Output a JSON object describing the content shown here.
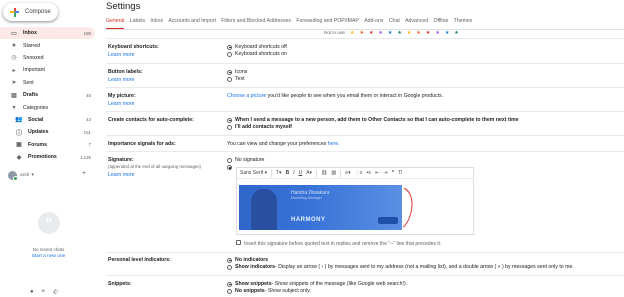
{
  "sidebar": {
    "compose_label": "Compose",
    "items": [
      {
        "label": "Inbox",
        "count": "189",
        "icon": "inbox-icon",
        "glyph": "▭",
        "active": true
      },
      {
        "label": "Starred",
        "count": "",
        "icon": "star-icon",
        "glyph": "★"
      },
      {
        "label": "Snoozed",
        "count": "",
        "icon": "clock-icon",
        "glyph": "◷"
      },
      {
        "label": "Important",
        "count": "",
        "icon": "important-icon",
        "glyph": "▸"
      },
      {
        "label": "Sent",
        "count": "",
        "icon": "send-icon",
        "glyph": "➤"
      },
      {
        "label": "Drafts",
        "count": "45",
        "icon": "draft-icon",
        "glyph": "▤",
        "bold": true
      },
      {
        "label": "Categories",
        "count": "",
        "icon": "label-icon",
        "glyph": "▾"
      },
      {
        "label": "Social",
        "count": "43",
        "icon": "people-icon",
        "glyph": "👥",
        "sub": true,
        "bold": true
      },
      {
        "label": "Updates",
        "count": "151",
        "icon": "info-icon",
        "glyph": "ⓘ",
        "sub": true,
        "bold": true
      },
      {
        "label": "Forums",
        "count": "7",
        "icon": "forum-icon",
        "glyph": "▣",
        "sub": true,
        "bold": true
      },
      {
        "label": "Promotions",
        "count": "1,125",
        "icon": "tag-icon",
        "glyph": "◆",
        "sub": true,
        "bold": true
      }
    ],
    "hangouts": {
      "user": "arsh",
      "no_chats": "No recent chats",
      "start_new": "Start a new one"
    }
  },
  "header": {
    "title": "Settings",
    "tabs": [
      "General",
      "Labels",
      "Inbox",
      "Accounts and Import",
      "Filters and Blocked Addresses",
      "Forwarding and POP/IMAP",
      "Add-ons",
      "Chat",
      "Advanced",
      "Offline",
      "Themes"
    ],
    "top_partial_label": "Not in use:",
    "star_colors": [
      "#fbbc04",
      "#f4511e",
      "#d93025",
      "#a142f4",
      "#1a73e8",
      "#0b8043",
      "#fbbc04",
      "#f4511e",
      "#d93025",
      "#a142f4",
      "#1a73e8",
      "#0b8043"
    ]
  },
  "settings": {
    "keyboard": {
      "label": "Keyboard shortcuts:",
      "learn": "Learn more",
      "off": "Keyboard shortcuts off",
      "on": "Keyboard shortcuts on"
    },
    "buttons": {
      "label": "Button labels:",
      "learn": "Learn more",
      "icons": "Icons",
      "text": "Text"
    },
    "picture": {
      "label": "My picture:",
      "learn": "Learn more",
      "link": "Choose a picture",
      "rest": "you'd like people to see when you email them or interact in Google products."
    },
    "contacts": {
      "label": "Create contacts for auto-complete:",
      "opt1_bold": "When I send a message to a new person, add them to Other Contacts so that I can auto-complete to them next time",
      "opt2_bold": "I'll add contacts myself"
    },
    "importance": {
      "label": "Importance signals for ads:",
      "text": "You can view and change your preferences",
      "link": "here."
    },
    "signature": {
      "label": "Signature:",
      "sub": "(appended at the end of all outgoing messages)",
      "learn": "Learn more",
      "none": "No signature",
      "font": "Sans Serif",
      "insert_text": "Insert this signature before quoted text in replies and remove the \"--\" line that precedes it.",
      "banner_name": "Harsha Diwakara",
      "banner_role": "Marketing Manager",
      "banner_logo": "HARMONY"
    },
    "indicators": {
      "label": "Personal level indicators:",
      "no": "No indicators",
      "show_bold": "Show indicators",
      "show_rest": " - Display an arrow ( › ) by messages sent to my address (not a mailing list), and a double arrow ( » ) by messages sent only to me."
    },
    "snippets": {
      "label": "Snippets:",
      "show_bold": "Show snippets",
      "show_rest": " - Show snippets of the message (like Google web search!).",
      "no_bold": "No snippets",
      "no_rest": " - Show subject only."
    }
  }
}
